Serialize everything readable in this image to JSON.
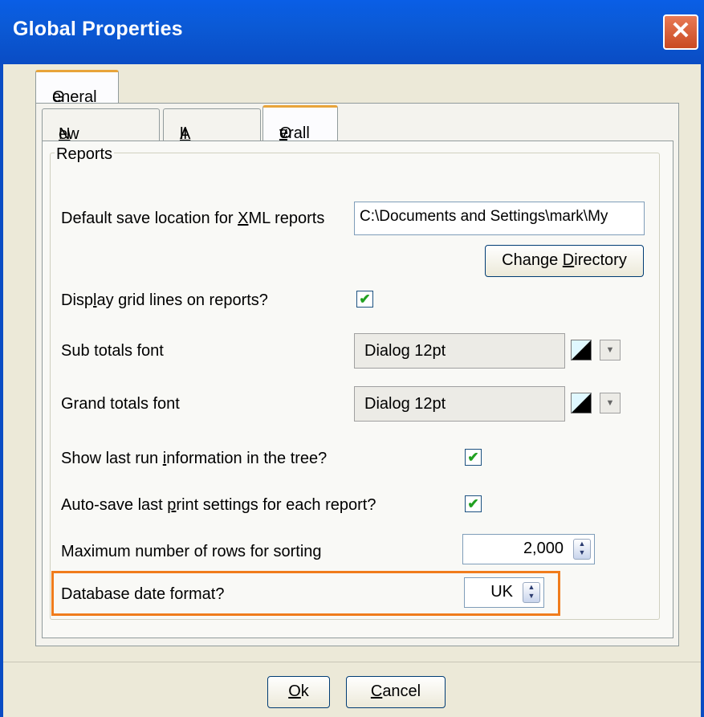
{
  "window": {
    "title": "Global Properties",
    "close_label": "✕"
  },
  "outer_tabs": [
    {
      "label_pre": "",
      "label_ul": "G",
      "label_post": "eneral"
    }
  ],
  "inner_tabs": [
    {
      "label_pre": "",
      "label_ul": "N",
      "label_post": "ew Queries"
    },
    {
      "label_pre": "",
      "label_ul": "A",
      "label_post": "ll Queries"
    },
    {
      "label_pre": "O",
      "label_ul": "v",
      "label_post": "erall"
    }
  ],
  "group": {
    "legend": "Reports"
  },
  "xml_location": {
    "label_pre": "Default save location for ",
    "label_ul": "X",
    "label_post": "ML reports",
    "value": "C:\\Documents and Settings\\mark\\My"
  },
  "change_directory": {
    "label_pre": "Change ",
    "label_ul": "D",
    "label_post": "irectory"
  },
  "grid_lines": {
    "label_pre": "Disp",
    "label_ul": "l",
    "label_post": "ay grid lines on reports?",
    "checked": "✔"
  },
  "sub_totals": {
    "label": "Sub totals font",
    "value": "Dialog 12pt"
  },
  "grand_totals": {
    "label": "Grand totals font",
    "value": "Dialog 12pt"
  },
  "arrow_glyph": "▼",
  "last_run": {
    "label_pre": "Show last run ",
    "label_ul": "i",
    "label_post": "nformation in the tree?",
    "checked": "✔"
  },
  "auto_save": {
    "label_pre": "Auto-save last ",
    "label_ul": "p",
    "label_post": "rint settings for each report?",
    "checked": "✔"
  },
  "max_rows": {
    "label": "Maximum number of rows for sorting",
    "value": "2,000",
    "up": "▲",
    "down": "▼"
  },
  "date_format": {
    "label": "Database date format?",
    "value": "UK",
    "up": "▲",
    "down": "▼"
  },
  "footer": {
    "ok": {
      "label_pre": "",
      "label_ul": "O",
      "label_post": "k"
    },
    "cancel": {
      "label_pre": "",
      "label_ul": "C",
      "label_post": "ancel"
    }
  },
  "colors": {
    "title_bar": "#0a5ee6",
    "active_tab_accent": "#e8a43a",
    "highlight": "#f07c1c",
    "check": "#21a121"
  }
}
